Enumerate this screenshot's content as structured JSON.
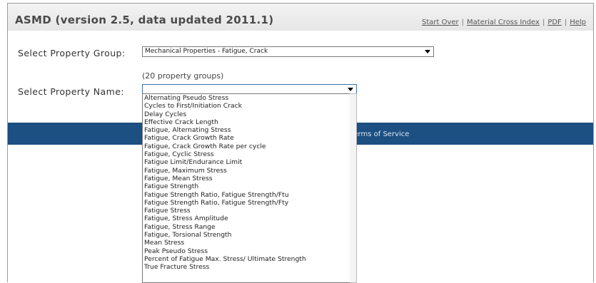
{
  "app": {
    "title": "ASMD (version 2.5, data updated 2011.1)"
  },
  "top_links": [
    {
      "label": "Start Over"
    },
    {
      "label": "Material Cross Index"
    },
    {
      "label": "PDF"
    },
    {
      "label": "Help"
    }
  ],
  "property_group": {
    "label": "Select Property Group:",
    "selected": "Mechanical Properties - Fatigue, Crack",
    "count_text": "(20 property groups)"
  },
  "property_name": {
    "label": "Select Property Name:",
    "selected": ""
  },
  "footer": {
    "tos": "Terms of Service"
  },
  "property_options": [
    "Alternating Pseudo Stress",
    "Cycles to First/Initiation Crack",
    "Delay Cycles",
    "Effective Crack Length",
    "Fatigue, Alternating Stress",
    "Fatigue, Crack Growth Rate",
    "Fatigue, Crack Growth Rate per cycle",
    "Fatigue, Cyclic Stress",
    "Fatigue Limit/Endurance Limit",
    "Fatigue, Maximum Stress",
    "Fatigue, Mean Stress",
    "Fatigue Strength",
    "Fatigue Strength Ratio, Fatigue Strength/Ftu",
    "Fatigue Strength Ratio, Fatigue Strength/Fty",
    "Fatigue Stress",
    "Fatigue, Stress Amplitude",
    "Fatigue, Stress Range",
    "Fatigue, Torsional Strength",
    "Mean Stress",
    "Peak Pseudo Stress",
    "Percent of Fatigue Max. Stress/ Ultimate Strength",
    "True Fracture Stress"
  ]
}
